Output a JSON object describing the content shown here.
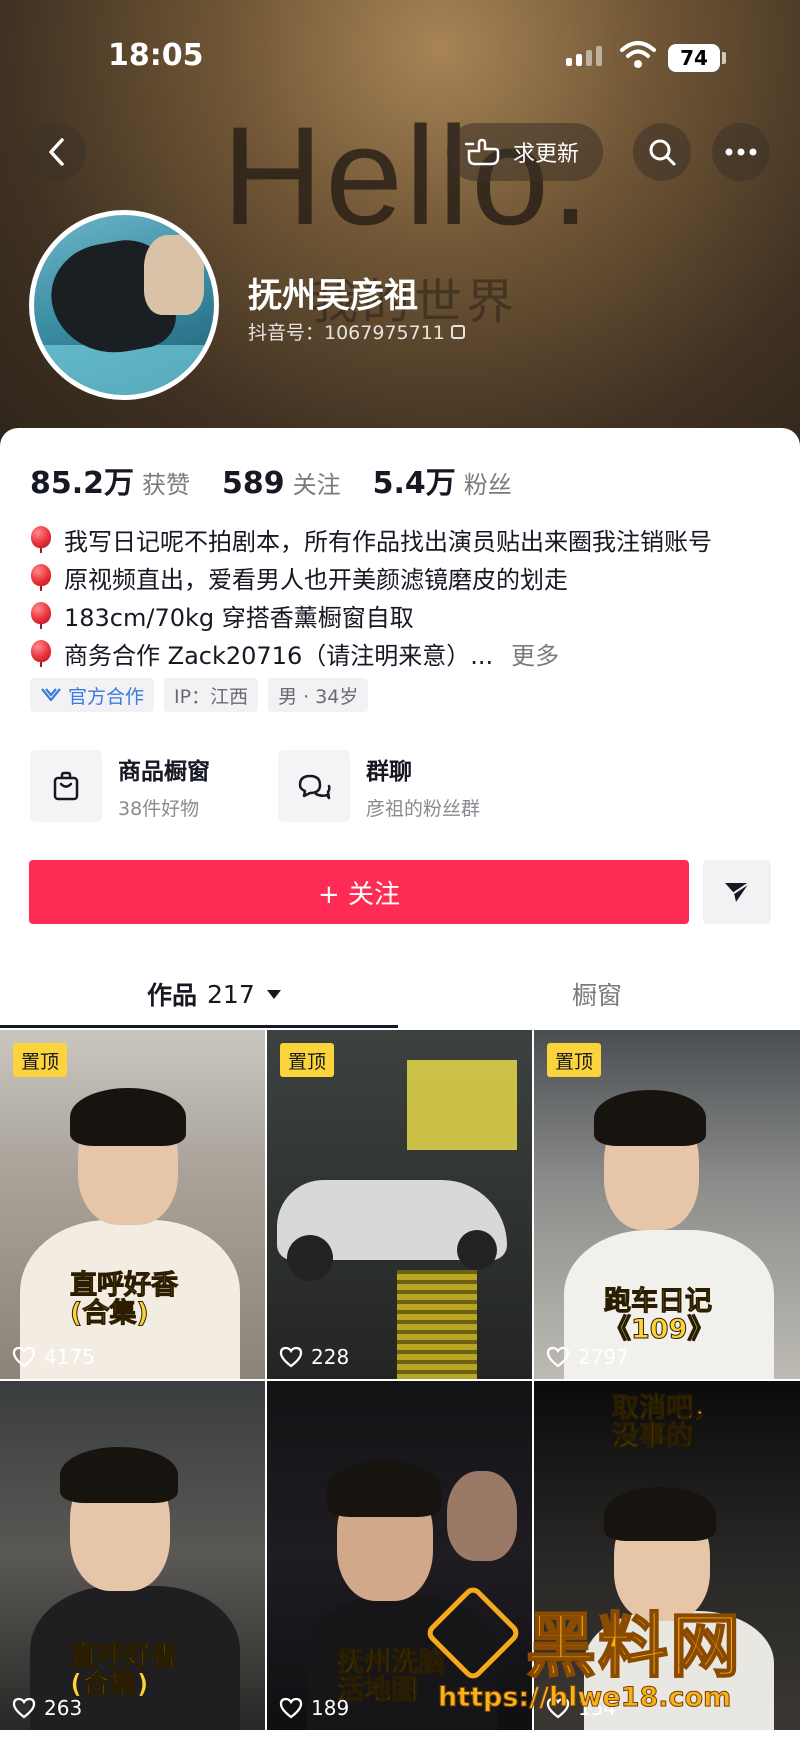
{
  "status_bar": {
    "time": "18:05",
    "battery": "74"
  },
  "cover": {
    "text_main": "Hello.",
    "text_sub": "我的世界"
  },
  "top_actions": {
    "request_update_label": "求更新"
  },
  "profile": {
    "nickname": "抚州吴彦祖",
    "douyin_id": "抖音号：1067975711"
  },
  "stats": [
    {
      "value": "85.2万",
      "label": "获赞"
    },
    {
      "value": "589",
      "label": "关注"
    },
    {
      "value": "5.4万",
      "label": "粉丝"
    }
  ],
  "bio": {
    "lines": [
      "我写日记呢不拍剧本，所有作品找出演员贴出来圈我注销账号",
      "原视频直出，爱看男人也开美颜滤镜磨皮的划走",
      "183cm/70kg 穿搭香薰橱窗自取",
      "商务合作 Zack20716（请注明来意）..."
    ],
    "more_label": "更多"
  },
  "tags": {
    "official": "官方合作",
    "ip": "IP：江西",
    "gender_age": "男 · 34岁"
  },
  "entries": [
    {
      "title": "商品橱窗",
      "subtitle": "38件好物",
      "icon": "shopping-bag-icon"
    },
    {
      "title": "群聊",
      "subtitle": "彦祖的粉丝群",
      "icon": "chat-bubbles-icon"
    }
  ],
  "follow_button": {
    "label": "+ 关注"
  },
  "tabs": {
    "works_label": "作品",
    "works_count": "217",
    "showcase_label": "橱窗"
  },
  "videos": [
    {
      "pinned_label": "置顶",
      "likes": "4175",
      "caption": "直呼好香\n(合集)"
    },
    {
      "pinned_label": "置顶",
      "likes": "228",
      "caption": ""
    },
    {
      "pinned_label": "置顶",
      "likes": "2797",
      "caption": "跑车日记\n《109》"
    },
    {
      "pinned_label": "",
      "likes": "263",
      "caption": "直呼好香\n(合集)"
    },
    {
      "pinned_label": "",
      "likes": "189",
      "caption": "抚州洗脑\n活地图"
    },
    {
      "pinned_label": "",
      "likes": "154",
      "caption": "取消吧，\n没事的"
    }
  ],
  "watermark": {
    "text": "黑料网",
    "url": "https://hlwe18.com"
  },
  "colors": {
    "accent": "#fe2c55",
    "pin": "#fbd43c",
    "text_primary": "#161823",
    "text_secondary": "#7a7b80"
  }
}
